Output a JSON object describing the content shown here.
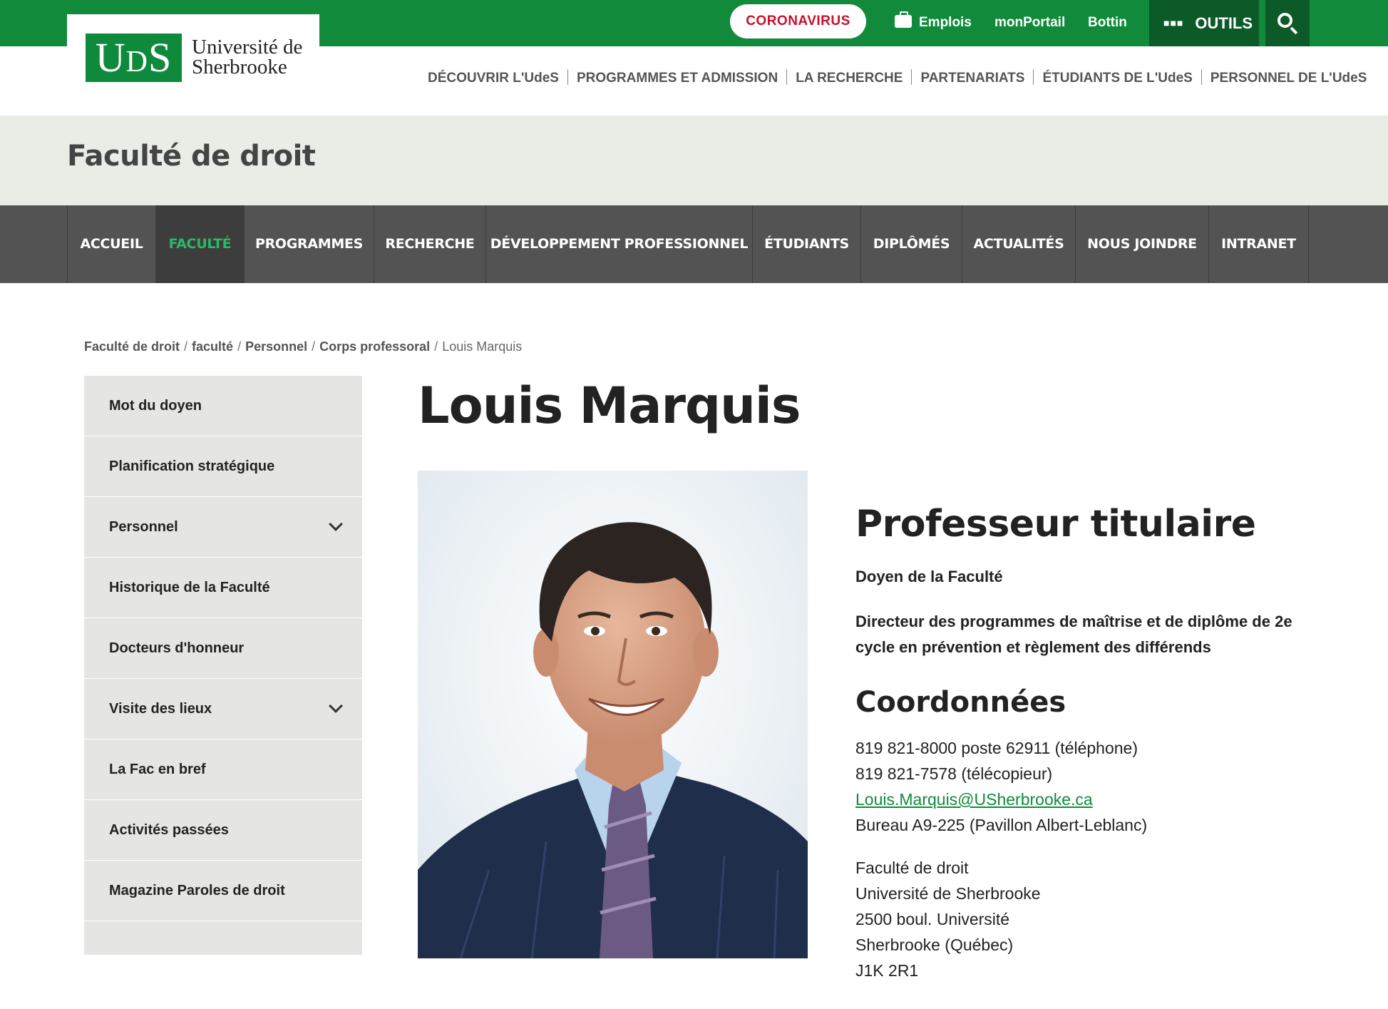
{
  "header": {
    "logo_mark": "UdS",
    "logo_line1": "Université de",
    "logo_line2": "Sherbrooke",
    "coronavirus_label": "CORONAVIRUS",
    "emplois_label": "Emplois",
    "monportail_label": "monPortail",
    "bottin_label": "Bottin",
    "outils_label": "OUTILS",
    "brand_green": "#118a3b",
    "dark_green": "#0b5a27"
  },
  "site_nav": [
    "DÉCOUVRIR L'UdeS",
    "PROGRAMMES ET ADMISSION",
    "LA RECHERCHE",
    "PARTENARIATS",
    "ÉTUDIANTS DE L'UdeS",
    "PERSONNEL DE L'UdeS"
  ],
  "faculty": {
    "name": "Faculté de droit"
  },
  "faculty_nav": {
    "active": "FACULTÉ",
    "active_color": "#2db866",
    "tabs": [
      "ACCUEIL",
      "FACULTÉ",
      "PROGRAMMES",
      "RECHERCHE",
      "DÉVELOPPEMENT PROFESSIONNEL",
      "ÉTUDIANTS",
      "DIPLÔMÉS",
      "ACTUALITÉS",
      "NOUS JOINDRE",
      "INTRANET"
    ]
  },
  "breadcrumb": {
    "items": [
      "Faculté de droit",
      "faculté",
      "Personnel",
      "Corps professoral"
    ],
    "current": "Louis Marquis"
  },
  "side_menu": [
    {
      "label": "Mot du doyen",
      "expandable": false
    },
    {
      "label": "Planification stratégique",
      "expandable": false
    },
    {
      "label": "Personnel",
      "expandable": true
    },
    {
      "label": "Historique de la Faculté",
      "expandable": false
    },
    {
      "label": "Docteurs d'honneur",
      "expandable": false
    },
    {
      "label": "Visite des lieux",
      "expandable": true
    },
    {
      "label": "La Fac en bref",
      "expandable": false
    },
    {
      "label": "Activités passées",
      "expandable": false
    },
    {
      "label": "Magazine Paroles de droit",
      "expandable": false
    }
  ],
  "profile": {
    "name": "Louis Marquis",
    "title": "Professeur titulaire",
    "role1": "Doyen de la Faculté",
    "role2": "Directeur des programmes de maîtrise et de diplôme de 2e cycle en prévention et règlement des différends",
    "coordinates_heading": "Coordonnées",
    "phone": "819 821-8000 poste 62911 (téléphone)",
    "fax": "819 821-7578 (télécopieur)",
    "email": "Louis.Marquis@USherbrooke.ca",
    "office": "Bureau A9-225 (Pavillon Albert-Leblanc)",
    "address": [
      "Faculté de droit",
      "Université de Sherbrooke",
      "2500 boul. Université",
      "Sherbrooke (Québec)",
      "J1K 2R1"
    ]
  }
}
